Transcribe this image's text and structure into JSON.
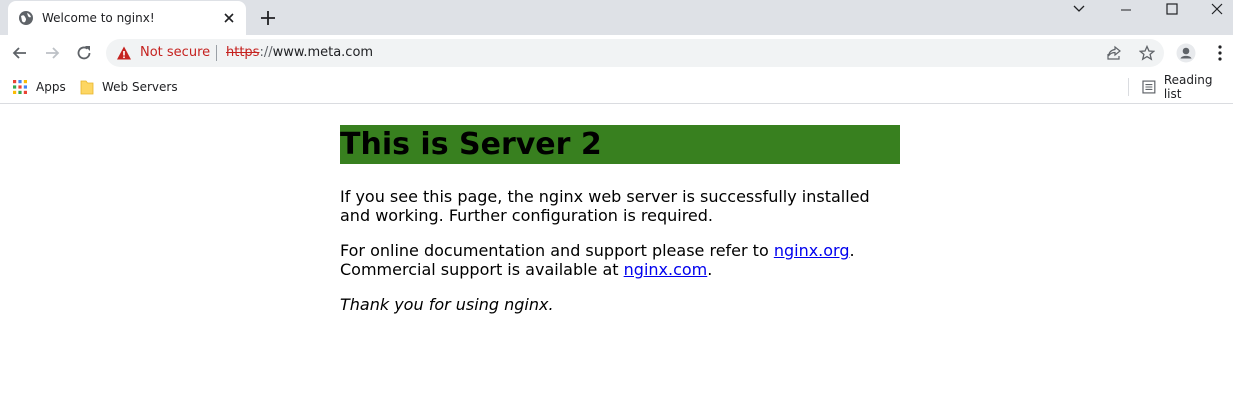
{
  "browser": {
    "tab": {
      "title": "Welcome to nginx!"
    },
    "address_bar": {
      "security_label": "Not secure",
      "url_scheme": "https",
      "url_separator": "://",
      "url_host": "www.meta.com"
    },
    "bookmarks": [
      {
        "label": "Apps",
        "icon": "apps-grid-icon"
      },
      {
        "label": "Web Servers",
        "icon": "folder-icon"
      }
    ],
    "reading_list_label": "Reading list"
  },
  "page": {
    "heading": "This is Server 2",
    "heading_bg_color": "#38801f",
    "para1": "If you see this page, the nginx web server is successfully installed and working. Further configuration is required.",
    "para2_prefix": "For online documentation and support please refer to ",
    "link1": "nginx.org",
    "para2_mid": ".",
    "para2_line2_prefix": "Commercial support is available at ",
    "link2": "nginx.com",
    "para2_end": ".",
    "para3": "Thank you for using nginx."
  }
}
